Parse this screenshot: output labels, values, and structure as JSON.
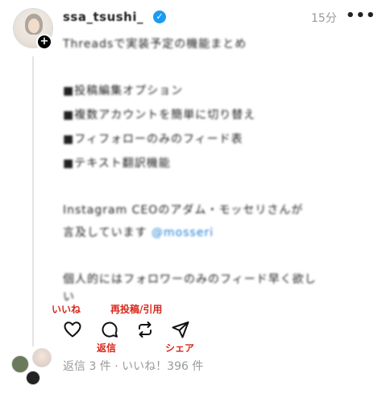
{
  "post": {
    "username": "ssa_tsushi_",
    "time": "15分",
    "more": "•••",
    "lines": [
      "Threadsで実装予定の機能まとめ",
      "■投稿編集オプション",
      "■複数アカウントを簡単に切り替え",
      "■フィフォローのみのフィード表",
      "■テキスト翻訳機能",
      "Instagram CEOのアダム・モッセリさんが",
      "言及しています",
      "@mosseri",
      "個人的にはフォロワーのみのフィード早く欲し",
      "い"
    ]
  },
  "annotations": {
    "like": "いいね",
    "repost": "再投稿/引用",
    "reply": "返信",
    "share": "シェア"
  },
  "icons": {
    "like": "heart-icon",
    "reply": "comment-icon",
    "repost": "repost-icon",
    "share": "send-icon"
  },
  "stats": "返信 3 件 · いいね！396 件"
}
